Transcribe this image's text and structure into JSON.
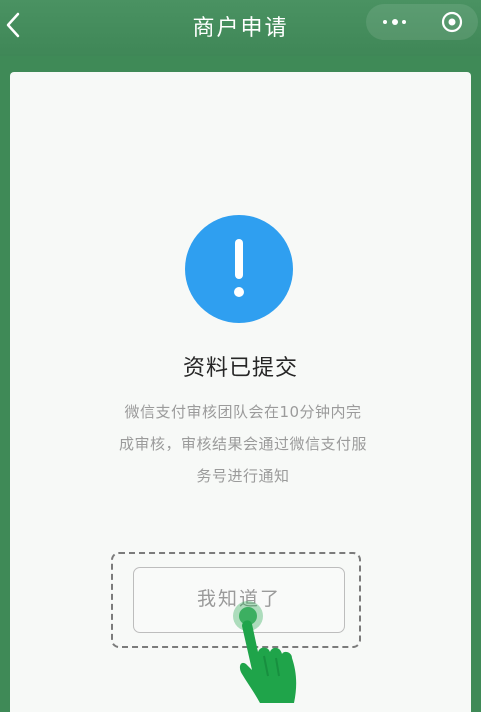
{
  "nav": {
    "title": "商户申请",
    "back_icon": "chevron-left-icon",
    "more_icon": "more-dots-icon",
    "close_icon": "target-circle-icon"
  },
  "result": {
    "icon": "exclamation-circle-icon",
    "title": "资料已提交",
    "description": "微信支付审核团队会在10分钟内完\n成审核，审核结果会通过微信支付服\n务号进行通知"
  },
  "actions": {
    "acknowledge_label": "我知道了"
  },
  "overlay": {
    "hand_icon": "tap-hand-icon"
  },
  "colors": {
    "nav_background": "#3f8a57",
    "status_icon": "#2f9ff0",
    "hand": "#1fa44a"
  }
}
